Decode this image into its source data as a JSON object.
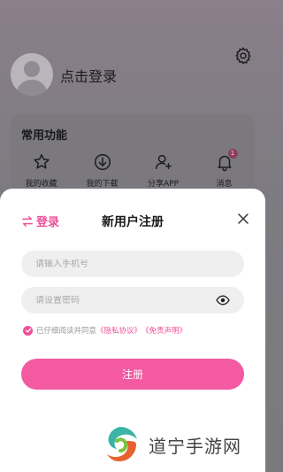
{
  "background": {
    "login_hint": "点击登录",
    "section_title": "常用功能",
    "functions": [
      {
        "label": "我的收藏",
        "icon": "star-icon"
      },
      {
        "label": "我的下载",
        "icon": "download-icon"
      },
      {
        "label": "分享APP",
        "icon": "share-user-icon"
      },
      {
        "label": "消息",
        "icon": "bell-icon",
        "badge": "1"
      }
    ]
  },
  "sheet": {
    "switch_label": "登录",
    "title": "新用户注册",
    "phone_placeholder": "请输入手机号",
    "password_placeholder": "请设置密码",
    "agree_prefix": "已仔细阅读并同意",
    "privacy_link": "《隐私协议》",
    "disclaimer_link": "《免责声明》",
    "submit_label": "注册"
  },
  "watermark": {
    "text": "道宁手游网"
  },
  "colors": {
    "accent": "#f0509a",
    "button": "#f35aa2"
  }
}
